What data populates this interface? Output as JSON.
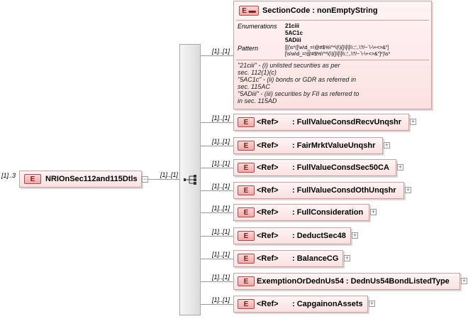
{
  "root": {
    "badge": "E",
    "name": "NRIOnSec112and115Dtls",
    "multiplicity": "[1]..3"
  },
  "sequence": {
    "multiplicity": "[1]..[1]"
  },
  "section_code": {
    "badge": "E",
    "name": "SectionCode : nonEmptyString",
    "multiplicity": "[1]..[1]",
    "enumerations_label": "Enumerations",
    "enumerations": [
      "21ciii",
      "5AC1c",
      "5ADiii"
    ],
    "pattern_label": "Pattern",
    "pattern_lines": [
      "[[(\\s*([\\w\\d_=!@#$%\\^*\\(\\){}\\[\\]\\\\:;',.\\?/~`\\-\\+<>&\"]",
      "[\\s\\w\\d_=!@#$%\\^*\\(\\){}\\[\\]\\\\:;',.\\?/~`\\-\\+<>&\"]*)\\s*"
    ],
    "doc_lines": [
      "\"21ciii\" - (i) unlisted securities as per",
      "sec. 112(1)(c)",
      "\"5AC1c\" - (ii) bonds or GDR as referred in",
      "sec. 115AC",
      "\"5ADiii\" - (iii) securities by FII as referred to",
      "in sec. 115AD"
    ]
  },
  "children": [
    {
      "badge": "E",
      "ref": "<Ref>",
      "name": ": FullValueConsdRecvUnqshr",
      "multiplicity": "[1]..[1]"
    },
    {
      "badge": "E",
      "ref": "<Ref>",
      "name": ": FairMrktValueUnqshr",
      "multiplicity": "[1]..[1]"
    },
    {
      "badge": "E",
      "ref": "<Ref>",
      "name": ": FullValueConsdSec50CA",
      "multiplicity": "[1]..[1]"
    },
    {
      "badge": "E",
      "ref": "<Ref>",
      "name": ": FullValueConsdOthUnqshr",
      "multiplicity": "[1]..[1]"
    },
    {
      "badge": "E",
      "ref": "<Ref>",
      "name": ": FullConsideration",
      "multiplicity": "[1]..[1]"
    },
    {
      "badge": "E",
      "ref": "<Ref>",
      "name": ": DeductSec48",
      "multiplicity": "[1]..[1]"
    },
    {
      "badge": "E",
      "ref": "<Ref>",
      "name": ": BalanceCG",
      "multiplicity": "[1]..[1]"
    },
    {
      "badge": "E",
      "ref": "",
      "name": "ExemptionOrDednUs54 : DednUs54BondListedType",
      "multiplicity": "[1]..[1]"
    },
    {
      "badge": "E",
      "ref": "<Ref>",
      "name": ": CapgainonAssets",
      "multiplicity": "[1]..[1]"
    }
  ],
  "icons": {
    "sequence": "sequence-icon",
    "expand": "plus-icon",
    "collapse": "minus-icon"
  }
}
